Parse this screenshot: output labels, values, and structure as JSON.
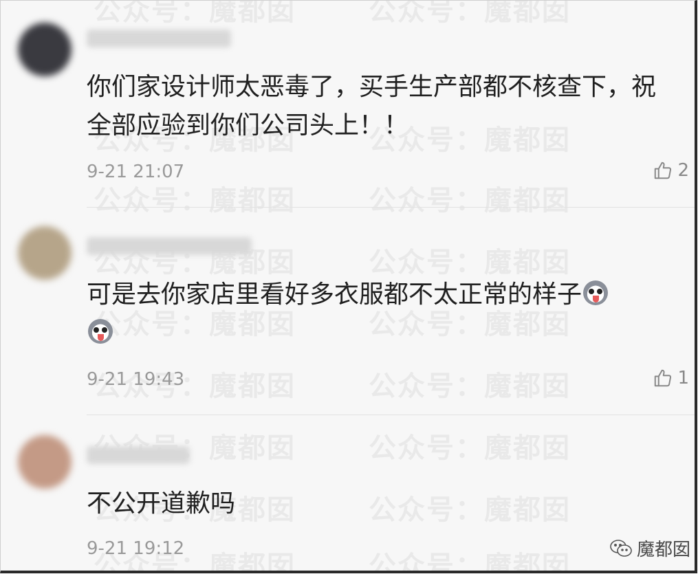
{
  "watermark": {
    "text": "公众号：魔都囡",
    "color": "#000000"
  },
  "comments": [
    {
      "username_hidden": true,
      "avatar_color": "#3a3a40",
      "text": "你们家设计师太恶毒了，买手生产部都不核查下，祝全部应验到你们公司头上！！",
      "emoji_count": 0,
      "time": "9-21 21:07",
      "likes": "2"
    },
    {
      "username_hidden": true,
      "avatar_color": "#b6a58a",
      "text": "可是去你家店里看好多衣服都不太正常的样子",
      "emoji_count": 2,
      "time": "9-21 19:43",
      "likes": "1"
    },
    {
      "username_hidden": true,
      "avatar_color": "#c49a86",
      "text": "不公开道歉吗",
      "emoji_count": 0,
      "time": "9-21 19:12",
      "likes": ""
    }
  ],
  "brand": {
    "icon": "wechat-icon",
    "label": "魔都囡"
  },
  "colors": {
    "background": "#f7f7f7",
    "text": "#202020",
    "meta": "#999999",
    "divider": "#e2e2e2"
  }
}
